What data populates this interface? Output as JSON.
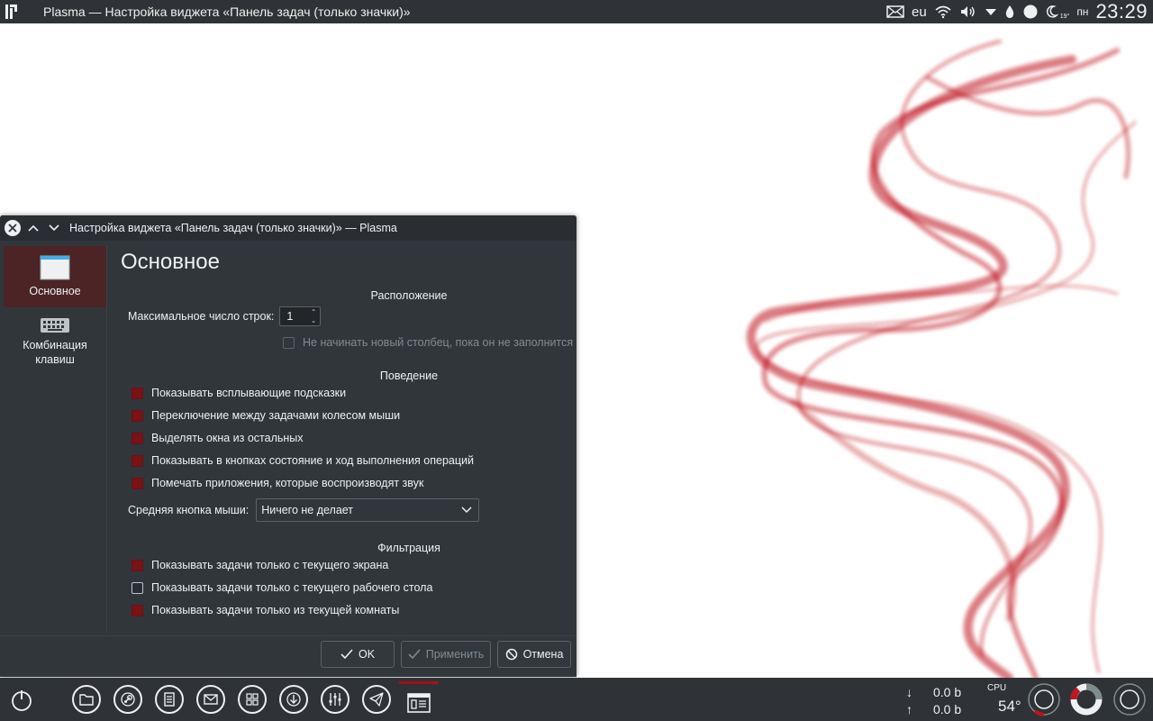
{
  "topbar": {
    "window_title": "Plasma — Настройка виджета «Панель задач (только значки)»",
    "keyboard_layout": "eu",
    "weather_temp": "19°",
    "day": "пн",
    "clock": "23:29"
  },
  "dialog": {
    "title": "Настройка виджета «Панель задач (только значки)» — Plasma",
    "sidebar": {
      "items": [
        {
          "label": "Основное",
          "icon": "window-icon",
          "active": true
        },
        {
          "label": "Комбинация клавиш",
          "icon": "keyboard-icon",
          "active": false
        }
      ]
    },
    "page_title": "Основное",
    "sections": {
      "layout": {
        "heading": "Расположение",
        "max_rows_label": "Максимальное число строк:",
        "max_rows_value": "1",
        "no_new_column_label": "Не начинать новый столбец, пока он не заполнится"
      },
      "behavior": {
        "heading": "Поведение",
        "options": [
          {
            "label": "Показывать всплывающие подсказки",
            "checked": true
          },
          {
            "label": "Переключение между задачами колесом мыши",
            "checked": true
          },
          {
            "label": "Выделять окна из остальных",
            "checked": true
          },
          {
            "label": "Показывать в кнопках состояние и ход выполнения операций",
            "checked": true
          },
          {
            "label": "Помечать приложения, которые воспроизводят звук",
            "checked": true
          }
        ],
        "middle_click_label": "Средняя кнопка мыши:",
        "middle_click_value": "Ничего не делает"
      },
      "filtering": {
        "heading": "Фильтрация",
        "options": [
          {
            "label": "Показывать задачи только с текущего экрана",
            "checked": true
          },
          {
            "label": "Показывать задачи только с текущего рабочего стола",
            "checked": false
          },
          {
            "label": "Показывать задачи только из текущей комнаты",
            "checked": true
          }
        ]
      }
    },
    "buttons": {
      "ok": "OK",
      "apply": "Применить",
      "cancel": "Отмена"
    }
  },
  "taskbar": {
    "launchers": [
      "folder-icon",
      "steam-icon",
      "document-icon",
      "mail-icon",
      "calculator-icon",
      "download-icon",
      "mixer-icon",
      "telegram-icon"
    ],
    "net_down": "0.0 b",
    "net_up": "0.0 b",
    "net_down_arrow": "↓",
    "net_up_arrow": "↑",
    "cpu_label": "CPU",
    "cpu_temp": "54°"
  },
  "colors": {
    "panel": "#2f3236",
    "dialog_bg": "#31363b",
    "accent": "#7b1216",
    "active_sidebar": "#4c2426"
  }
}
